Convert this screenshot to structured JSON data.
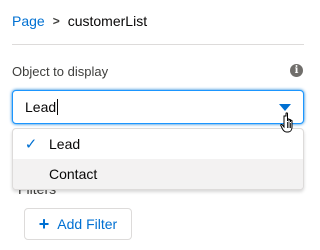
{
  "breadcrumb": {
    "root": "Page",
    "separator": ">",
    "current": "customerList"
  },
  "object_field": {
    "label": "Object to display",
    "info_icon": "info-icon",
    "value": "Lead",
    "selected_index": 0,
    "options": [
      {
        "label": "Lead",
        "selected": true
      },
      {
        "label": "Contact",
        "selected": false
      }
    ]
  },
  "filters": {
    "label": "Filters",
    "add_button_label": "Add Filter",
    "add_icon": "plus-icon"
  },
  "colors": {
    "accent": "#0070d2",
    "focus_border": "#1b96ff",
    "hover_bg": "#f3f2f2"
  }
}
